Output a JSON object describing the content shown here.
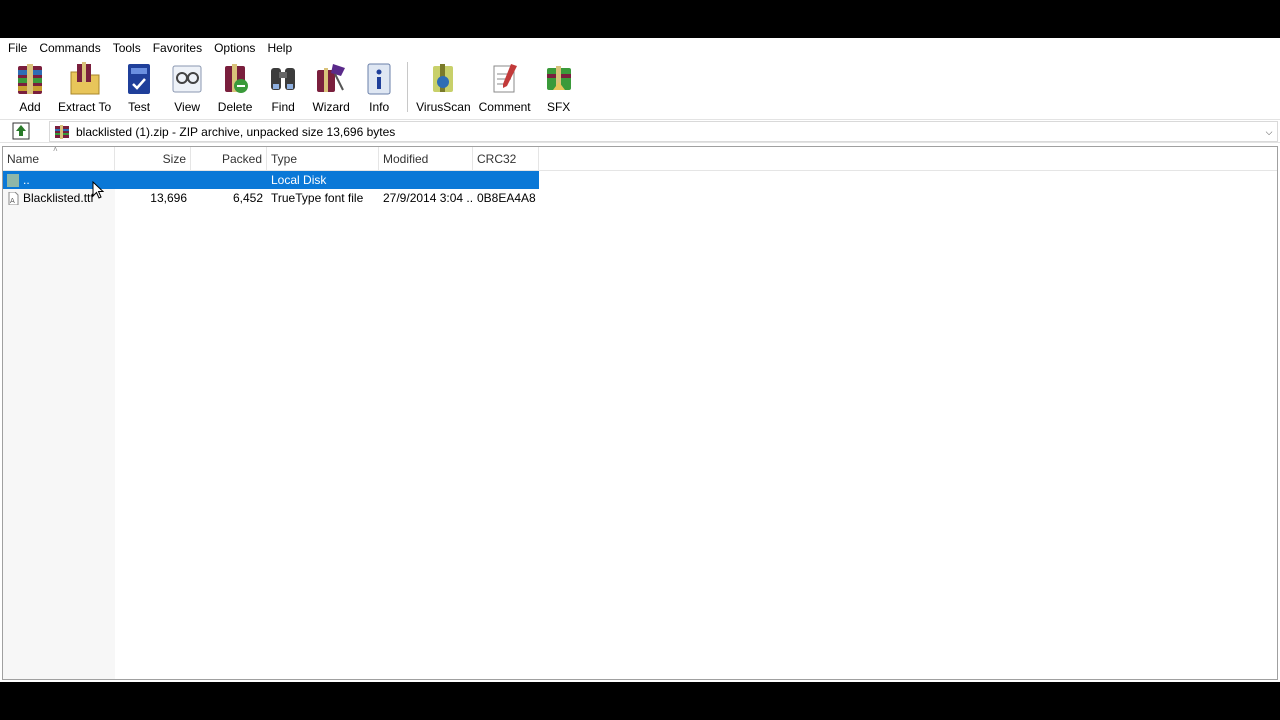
{
  "menu": [
    "File",
    "Commands",
    "Tools",
    "Favorites",
    "Options",
    "Help"
  ],
  "toolbar": [
    {
      "label": "Add",
      "icon": "add-icon"
    },
    {
      "label": "Extract To",
      "icon": "extract-to-icon"
    },
    {
      "label": "Test",
      "icon": "test-icon"
    },
    {
      "label": "View",
      "icon": "view-icon"
    },
    {
      "label": "Delete",
      "icon": "delete-icon"
    },
    {
      "label": "Find",
      "icon": "find-icon"
    },
    {
      "label": "Wizard",
      "icon": "wizard-icon"
    },
    {
      "label": "Info",
      "icon": "info-icon"
    },
    {
      "label": "VirusScan",
      "icon": "virusscan-icon"
    },
    {
      "label": "Comment",
      "icon": "comment-icon"
    },
    {
      "label": "SFX",
      "icon": "sfx-icon"
    }
  ],
  "address": {
    "text": "blacklisted (1).zip - ZIP archive, unpacked size 13,696 bytes",
    "icon": "winrar-archive-icon"
  },
  "columns": {
    "name": "Name",
    "size": "Size",
    "packed": "Packed",
    "type": "Type",
    "modified": "Modified",
    "crc": "CRC32"
  },
  "rows": [
    {
      "name": "..",
      "size": "",
      "packed": "",
      "type": "Local Disk",
      "modified": "",
      "crc": "",
      "selected": true,
      "icon": "parent-folder-icon"
    },
    {
      "name": "Blacklisted.ttf",
      "size": "13,696",
      "packed": "6,452",
      "type": "TrueType font file",
      "modified": "27/9/2014 3:04 ...",
      "crc": "0B8EA4A8",
      "selected": false,
      "icon": "font-file-icon"
    }
  ],
  "colors": {
    "selection": "#0a78d7",
    "window_bg": "#ffffff",
    "frame_bg": "#000000"
  }
}
